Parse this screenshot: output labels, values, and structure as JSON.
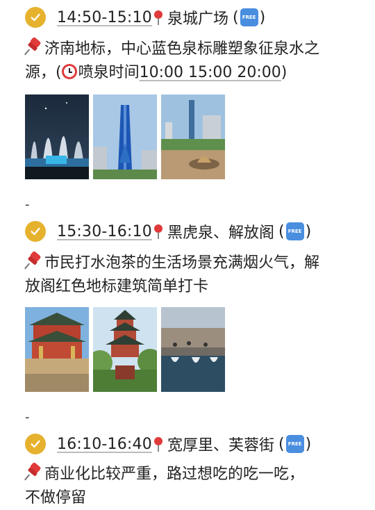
{
  "sections": [
    {
      "time": "14:50-15:10",
      "place": "泉城广场",
      "open_paren": "(",
      "free_label": "FREE",
      "close_paren": ")",
      "desc_line1": "济南地标，中心蓝色泉标雕塑象征泉水之",
      "desc_line2_pre": "源，(",
      "desc_line2_label": "喷泉时间",
      "desc_line2_times": "10:00 15:00 20:00",
      "desc_line2_post": ")",
      "separator": "-"
    },
    {
      "time": "15:30-16:10",
      "place": "黑虎泉、解放阁",
      "open_paren": "(",
      "free_label": "FREE",
      "close_paren": ")",
      "desc_line1": "市民打水泡茶的生活场景充满烟火气，解",
      "desc_line2": "放阁红色地标建筑简单打卡",
      "separator": "-"
    },
    {
      "time": "16:10-16:40",
      "place": "宽厚里、芙蓉街",
      "open_paren": "(",
      "free_label": "FREE",
      "close_paren": ")",
      "desc_line1": "商业化比较严重，路过想吃的吃一吃，",
      "desc_line2": "不做停留"
    }
  ],
  "icons": {
    "check": "check-circle-icon",
    "pin": "round-pushpin-icon",
    "pushpin": "pushpin-icon",
    "clock": "alarm-clock-icon",
    "free": "free-button-icon"
  },
  "colors": {
    "check_bg": "#e6b22e",
    "pin_red": "#e03a3a",
    "free_blue": "#4a8ee0"
  }
}
